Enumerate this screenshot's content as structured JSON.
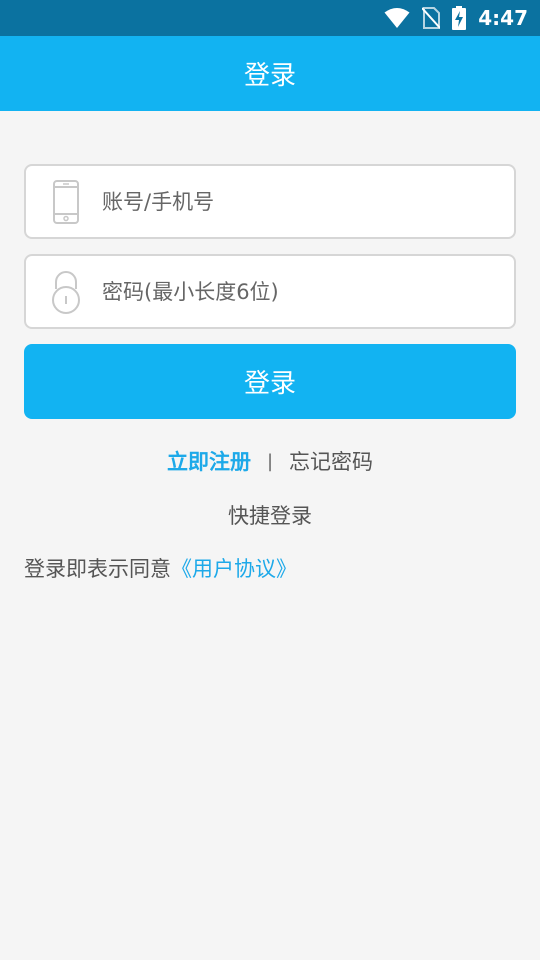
{
  "status_bar": {
    "time": "4:47",
    "icons": [
      "wifi-icon",
      "no-sim-icon",
      "battery-charging-icon"
    ]
  },
  "app_bar": {
    "title": "登录"
  },
  "form": {
    "account_placeholder": "账号/手机号",
    "account_icon": "phone-icon",
    "password_placeholder": "密码(最小长度6位)",
    "password_icon": "lock-icon",
    "login_button": "登录"
  },
  "links": {
    "register": "立即注册",
    "divider": "|",
    "forgot_password": "忘记密码",
    "quick_login": "快捷登录"
  },
  "agreement": {
    "prefix": "登录即表示同意",
    "link": "《用户协议》"
  },
  "colors": {
    "status_bar": "#0b72a0",
    "primary": "#12b3f2",
    "link": "#1da9e9",
    "background": "#f5f5f5"
  }
}
